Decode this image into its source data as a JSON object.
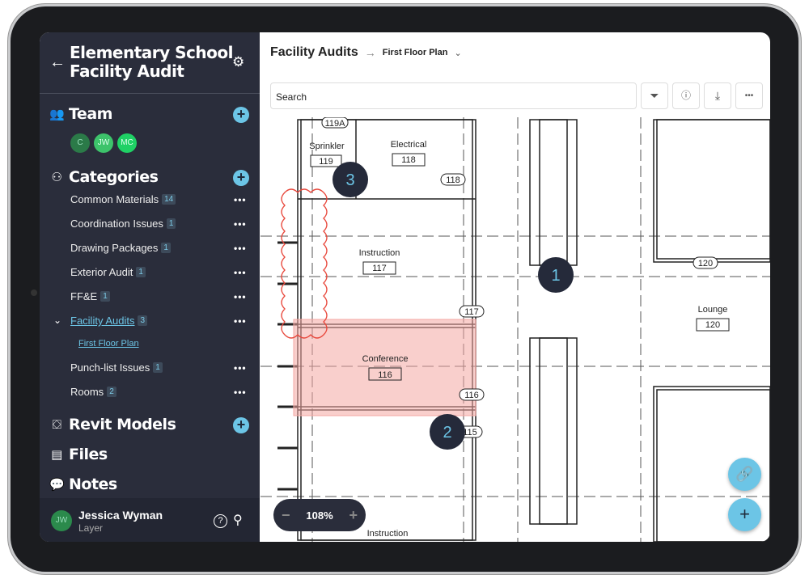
{
  "sidebar": {
    "title_line1": "Elementary School",
    "title_line2": "Facility Audit",
    "team": {
      "label": "Team",
      "members": [
        "C",
        "JW",
        "MC"
      ]
    },
    "categories": {
      "label": "Categories",
      "items": [
        {
          "label": "Common Materials",
          "count": "14"
        },
        {
          "label": "Coordination Issues",
          "count": "1"
        },
        {
          "label": "Drawing Packages",
          "count": "1"
        },
        {
          "label": "Exterior Audit",
          "count": "1"
        },
        {
          "label": "FF&E",
          "count": "1"
        },
        {
          "label": "Facility Audits",
          "count": "3",
          "expanded": true,
          "sub": "First Floor Plan"
        },
        {
          "label": "Punch-list Issues",
          "count": "1"
        },
        {
          "label": "Rooms",
          "count": "2"
        }
      ]
    },
    "revit": "Revit Models",
    "files": "Files",
    "notes": "Notes",
    "user": {
      "initials": "JW",
      "name": "Jessica Wyman",
      "role": "Layer"
    }
  },
  "header": {
    "title": "Facility Audits",
    "arrow": "→",
    "sheet": "First Floor Plan"
  },
  "search": {
    "placeholder": "Search"
  },
  "toolbar": {
    "more": "•••"
  },
  "plan": {
    "rooms": [
      {
        "name": "Sprinkler",
        "num": "119"
      },
      {
        "name": "Electrical",
        "num": "118"
      },
      {
        "name": "Instruction",
        "num": "117"
      },
      {
        "name": "Conference",
        "num": "116"
      },
      {
        "name": "Lounge",
        "num": "120"
      },
      {
        "name": "Instruction"
      }
    ],
    "tags": [
      "119A",
      "118",
      "117",
      "116",
      "115",
      "120"
    ],
    "pins": [
      "3",
      "1",
      "2"
    ]
  },
  "zoom": {
    "minus": "−",
    "value": "108%",
    "plus": "+"
  },
  "colors": {
    "accent": "#6cc5e6",
    "sidebar": "#2a2d3b",
    "highlight": "#f4a7a3",
    "markup": "#e8473b"
  }
}
